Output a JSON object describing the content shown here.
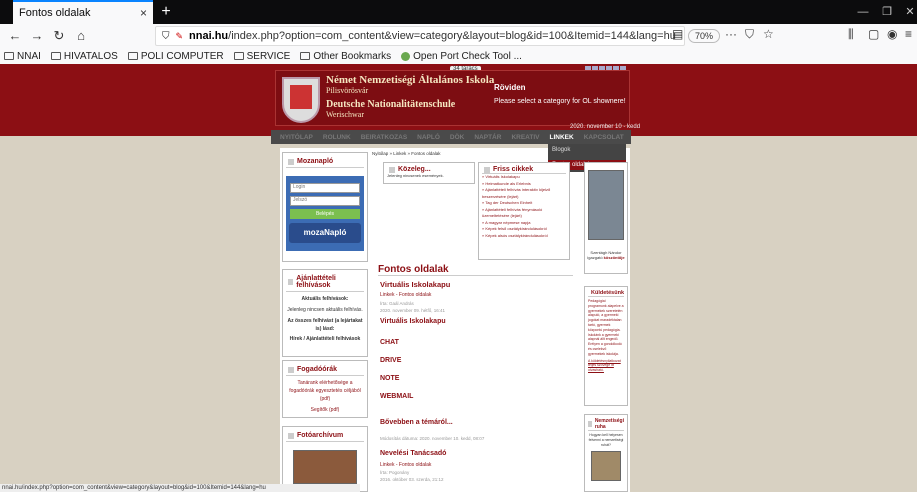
{
  "browser": {
    "tab_title": "Fontos oldalak",
    "tab_close": "×",
    "new_tab": "+",
    "url_prefix": "nnai.hu",
    "url_rest": "/index.php?option=com_content&view=category&layout=blog&id=100&Itemid=144&lang=hu",
    "zoom": "70%",
    "status_url": "nnai.hu/index.php?option=com_content&view=category&layout=blog&id=100&Itemid=144&lang=hu"
  },
  "bookmarks": [
    {
      "label": "NNAI"
    },
    {
      "label": "HIVATALOS"
    },
    {
      "label": "POLI COMPUTER"
    },
    {
      "label": "SERVICE"
    },
    {
      "label": "Other Bookmarks"
    },
    {
      "label": "Open Port Check Tool ..."
    }
  ],
  "site": {
    "counter": "34 tárács",
    "name1": "Német Nemzetiségi Általános Iskola",
    "name2": "Pilisvörösvár",
    "name3": "Deutsche Nationalitätenschule",
    "name4": "Werischwar",
    "rovid_title": "Röviden",
    "rovid_text": "Please select a category for OL shownere!",
    "date": "2020. november 10 - kedd",
    "menu": [
      "NYITÓLAP",
      "ROLUNK",
      "BEIRATKOZAS",
      "NAPLÓ",
      "DÖK",
      "NAPTÁR",
      "KREATIV",
      "LINKEK",
      "KAPCSOLAT"
    ],
    "dropdown_1": "Blogok",
    "dropdown_2": "Fontos oldalak"
  },
  "left": {
    "mozanaplo_title": "Mozanapló",
    "login_placeholder": "Login",
    "password_placeholder": "Jelszó",
    "login_button": "Belépés",
    "moza_logo": "mozaNapló",
    "ajanlat_title": "Ajánlattételi felhívások",
    "ajanlat_sub": "Aktuális felhívások:",
    "ajanlat_text": "Jelenleg nincsen aktuális felhívás.",
    "ajanlat_link": "Az összes felhívást (a lejártakat is) lásd:",
    "ajanlat_link2": "Hírek / Ajánlattételi felhívások",
    "fogadoorak_title": "Fogadóórák",
    "fogadoorak_text": "Tanárank elérhetősége a fogadóórák egyesztetés céljából (pdf)",
    "fogadoorak_link": "Segítők (pdf)",
    "foto_title": "Fotóarchívum"
  },
  "center": {
    "breadcrumb": "Nyitólap » Linkek » Fontos oldalak",
    "kozeleg_title": "Közeleg...",
    "kozeleg_text": "Jelenleg nincsenek események.",
    "friss_title": "Friss cikkek",
    "friss_items": [
      "Virtuális Iskolakapu",
      "Heimatkunde als Erlebnis",
      "Ajánlattételi felhívás interaktív kijelző beszerzésére (lejárt)",
      "Tag der Deutschen Einheit",
      "Ajánlattételi felhívás fénymásoló üzemeltetésére (lejárt)",
      "A magyar népmese napja",
      "Képek felső osztálykirándulásokról",
      "Képek alsós osztálykirándulásokról"
    ],
    "page_title": "Fontos oldalak",
    "article1_title": "Virtuális Iskolakapu",
    "article1_cat": "Linkek - Fontos oldalak",
    "article1_author": "Írta: Gaál András",
    "article1_date": "2020. november 09. hétfő, 16:41",
    "article1_heading": "Virtuális Iskolakapu",
    "links": [
      "CHAT",
      "DRIVE",
      "NOTE",
      "WEBMAIL"
    ],
    "more": "Bővebben a témáról...",
    "modified": "Módosítás dátuma: 2020. november 10. kedd, 08:07",
    "article2_title": "Nevelési Tanácsadó",
    "article2_cat": "Linkek - Fontos oldalak",
    "article2_author": "Írta: Pogonány",
    "article2_date": "2016. október 03. szerda, 21:12"
  },
  "right": {
    "principal_caption": "Szentágh Nándor igazgató",
    "principal_link": "köszöntője",
    "kuldetes_title": "Küldetésünk",
    "kuldetes_text": "Pedagógiai programunk alapelve a gyermekek szeretetén alapuló, a gyermeki jogokat maradéktalan tartó, gyermek központú pedagógia. Iskolánk a gyermeki alapnál állt engedő. Erélyen a gondolkodó és cselekvő gyermekek iskolája.",
    "kuldetes_link": "A küldetésnyilatkozat teljes szövege itt olvasható.",
    "ruha_title": "Nemzetiségi ruha",
    "ruha_text": "Hogyan kell helyesen felvenni a nemzetiségi ruhát?"
  }
}
